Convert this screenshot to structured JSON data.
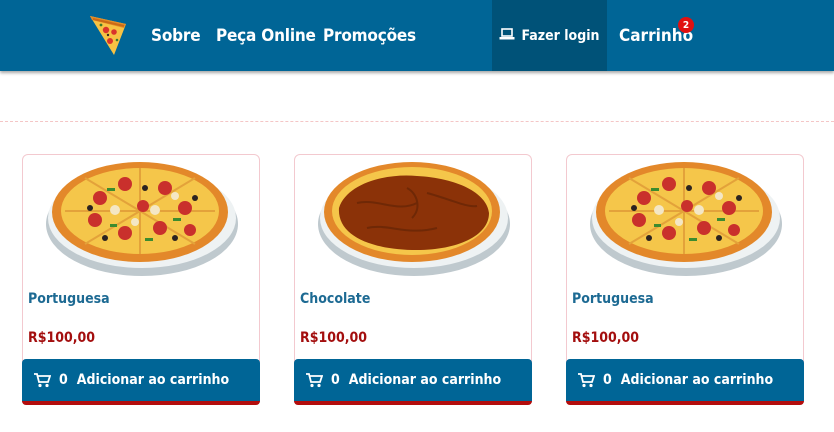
{
  "nav": {
    "items": [
      "Sobre",
      "Peça Online",
      "Promoções"
    ],
    "login_label": "Fazer login",
    "cart_label": "Carrinho",
    "cart_count": "2"
  },
  "products": [
    {
      "name": "Portuguesa",
      "price": "R$100,00",
      "qty": "0",
      "button_label": "Adicionar ao carrinho",
      "image": "pizza-portuguesa"
    },
    {
      "name": "Chocolate",
      "price": "R$100,00",
      "qty": "0",
      "button_label": "Adicionar ao carrinho",
      "image": "pizza-chocolate"
    },
    {
      "name": "Portuguesa",
      "price": "R$100,00",
      "qty": "0",
      "button_label": "Adicionar ao carrinho",
      "image": "pizza-portuguesa"
    }
  ],
  "colors": {
    "header": "#006596",
    "login_bg": "#005278",
    "price": "#a30e0e",
    "name": "#1d6a93",
    "badge": "#e01010"
  }
}
